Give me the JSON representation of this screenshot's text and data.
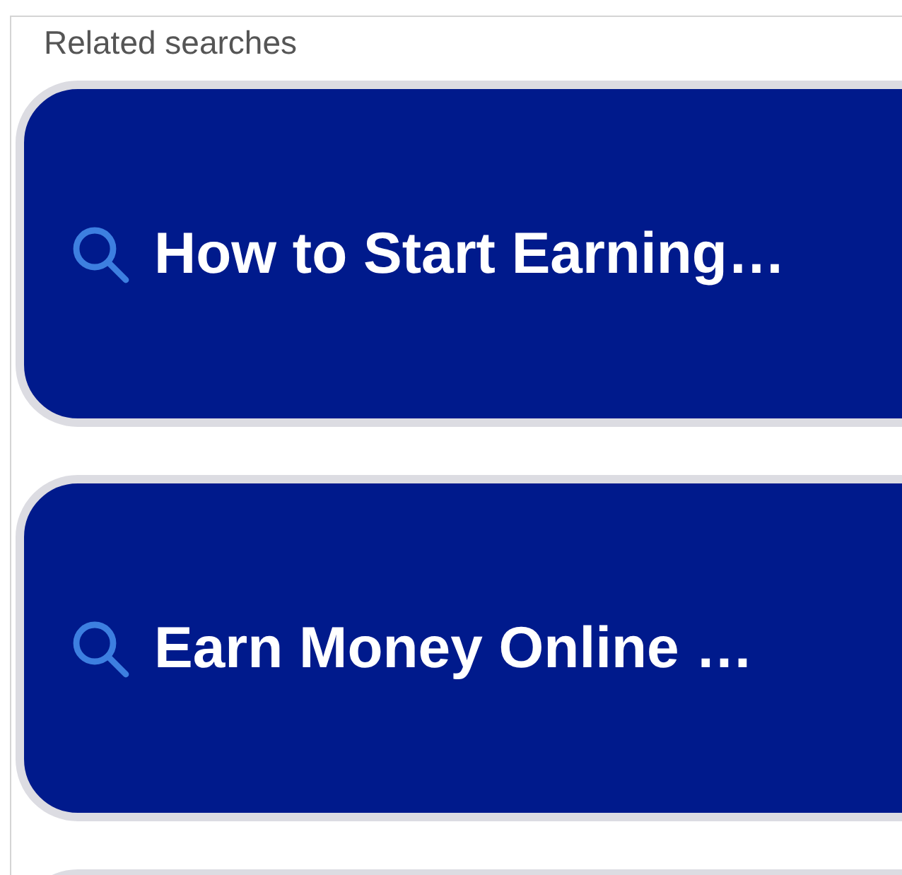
{
  "heading": "Related searches",
  "searches": [
    {
      "text": "How to Start Earning…"
    },
    {
      "text": "Earn Money Online …"
    }
  ]
}
